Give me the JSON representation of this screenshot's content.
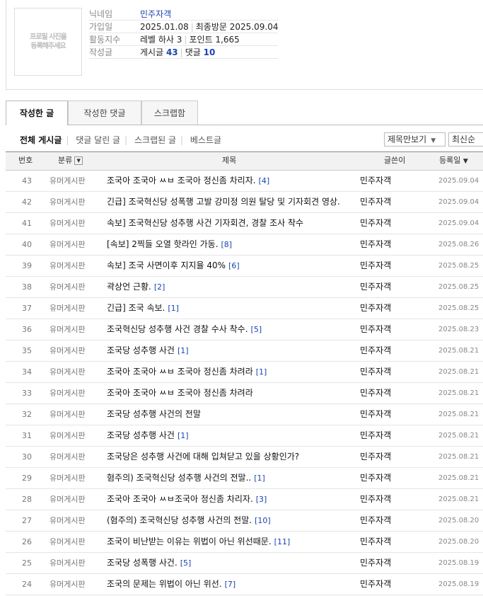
{
  "profile": {
    "photo_placeholder": "프로필 사진을\n등록해주세요",
    "nickname_label": "닉네임",
    "nickname": "민주자객",
    "joined_label": "가입일",
    "joined": "2025.01.08",
    "last_visit_label": "최종방문",
    "last_visit": "2025.09.04",
    "activity_label": "활동지수",
    "level": "레벨 하사 3",
    "points_label": "포인트",
    "points": "1,665",
    "posts_label": "작성글",
    "post_count_label": "게시글",
    "post_count": "43",
    "comment_count_label": "댓글",
    "comment_count": "10"
  },
  "tabs": [
    "작성한 글",
    "작성한 댓글",
    "스크랩함"
  ],
  "subnav": [
    "전체 게시글",
    "댓글 달린 글",
    "스크랩된 글",
    "베스트글"
  ],
  "view_select": "제목만보기",
  "sort_select": "최신순",
  "columns": {
    "no": "번호",
    "category": "분류",
    "title": "제목",
    "author": "글쓴이",
    "date": "등록일"
  },
  "rows": [
    {
      "no": "43",
      "category": "유머게시판",
      "title": "조국아 조국아 ㅆㅂ 조국아 정신좀 차리자.",
      "count": "[4]",
      "author": "민주자객",
      "date": "2025.09.04"
    },
    {
      "no": "42",
      "category": "유머게시판",
      "title": "긴급] 조국혁신당 성폭행 고발 강미정 의원 탈당 및 기자회견 영상.",
      "count": "",
      "author": "민주자객",
      "date": "2025.09.04"
    },
    {
      "no": "41",
      "category": "유머게시판",
      "title": "속보] 조국혁신당 성추행 사건 기자회견, 경찰 조사 착수",
      "count": "",
      "author": "민주자객",
      "date": "2025.09.04"
    },
    {
      "no": "40",
      "category": "유머게시판",
      "title": "[속보] 2찍들 오열 핫라인 가동.",
      "count": "[8]",
      "author": "민주자객",
      "date": "2025.08.26"
    },
    {
      "no": "39",
      "category": "유머게시판",
      "title": "속보] 조국 사면이후 지지율 40%",
      "count": "[6]",
      "author": "민주자객",
      "date": "2025.08.25"
    },
    {
      "no": "38",
      "category": "유머게시판",
      "title": "곽상언 근황.",
      "count": "[2]",
      "author": "민주자객",
      "date": "2025.08.25"
    },
    {
      "no": "37",
      "category": "유머게시판",
      "title": "긴급] 조국 속보.",
      "count": "[1]",
      "author": "민주자객",
      "date": "2025.08.25"
    },
    {
      "no": "36",
      "category": "유머게시판",
      "title": "조국혁신당 성추행 사건 경찰 수사 착수.",
      "count": "[5]",
      "author": "민주자객",
      "date": "2025.08.23"
    },
    {
      "no": "35",
      "category": "유머게시판",
      "title": "조국당 성추행 사건",
      "count": "[1]",
      "author": "민주자객",
      "date": "2025.08.21"
    },
    {
      "no": "34",
      "category": "유머게시판",
      "title": "조국아 조국아 ㅆㅂ 조국아 정신좀 차려라",
      "count": "[1]",
      "author": "민주자객",
      "date": "2025.08.21"
    },
    {
      "no": "33",
      "category": "유머게시판",
      "title": "조국아 조국아 ㅆㅂ 조국아 정신좀 차려라",
      "count": "",
      "author": "민주자객",
      "date": "2025.08.21"
    },
    {
      "no": "32",
      "category": "유머게시판",
      "title": "조국당 성추행 사건의 전말",
      "count": "",
      "author": "민주자객",
      "date": "2025.08.21"
    },
    {
      "no": "31",
      "category": "유머게시판",
      "title": "조국당 성추행 사건",
      "count": "[1]",
      "author": "민주자객",
      "date": "2025.08.21"
    },
    {
      "no": "30",
      "category": "유머게시판",
      "title": "조국당은 성추행 사건에 대해 입쳐닫고 있을 상황인가?",
      "count": "",
      "author": "민주자객",
      "date": "2025.08.21"
    },
    {
      "no": "29",
      "category": "유머게시판",
      "title": "혐주의) 조국혁신당 성추행 사건의 전말..",
      "count": "[1]",
      "author": "민주자객",
      "date": "2025.08.21"
    },
    {
      "no": "28",
      "category": "유머게시판",
      "title": "조국아 조국아 ㅆㅂ조국아 정신좀 차리자.",
      "count": "[3]",
      "author": "민주자객",
      "date": "2025.08.21"
    },
    {
      "no": "27",
      "category": "유머게시판",
      "title": "(혐주의) 조국혁신당 성추행 사건의 전말.",
      "count": "[10]",
      "author": "민주자객",
      "date": "2025.08.20"
    },
    {
      "no": "26",
      "category": "유머게시판",
      "title": "조국이 비난받는 이유는 위법이 아닌 위선때문.",
      "count": "[11]",
      "author": "민주자객",
      "date": "2025.08.20"
    },
    {
      "no": "25",
      "category": "유머게시판",
      "title": "조국당 성폭행 사건.",
      "count": "[5]",
      "author": "민주자객",
      "date": "2025.08.19"
    },
    {
      "no": "24",
      "category": "유머게시판",
      "title": "조국의 문제는 위법이 아닌 위선.",
      "count": "[7]",
      "author": "민주자객",
      "date": "2025.08.19"
    }
  ]
}
